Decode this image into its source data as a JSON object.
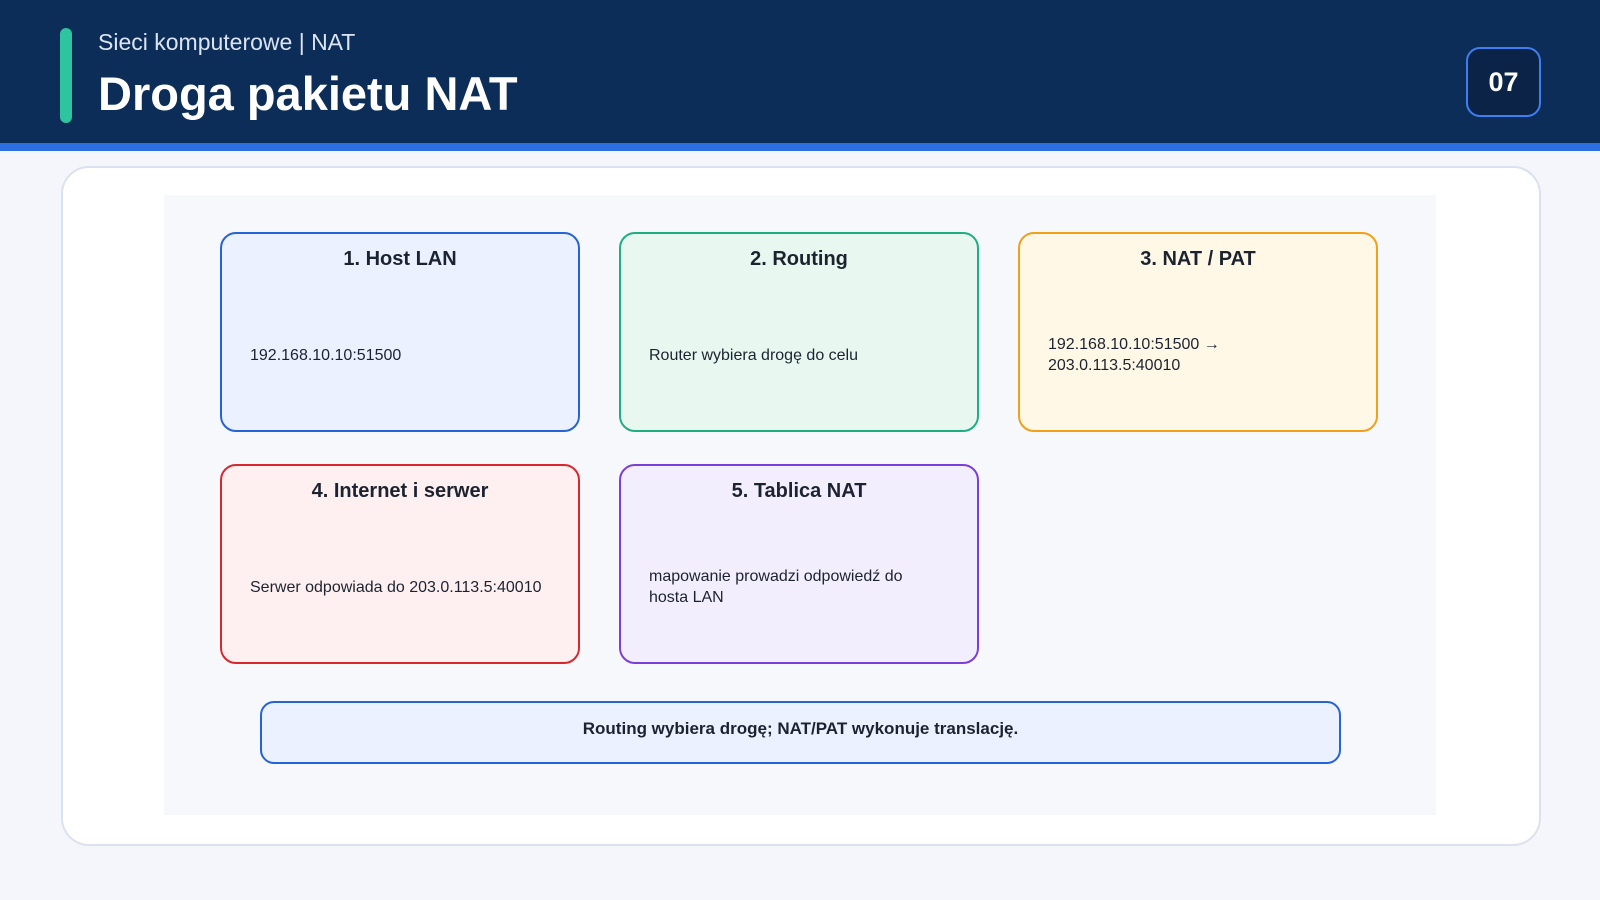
{
  "header": {
    "subtitle": "Sieci komputerowe | NAT",
    "title": "Droga pakietu NAT",
    "slide_number": "07"
  },
  "colors": {
    "header_bg": "#0c2d57",
    "header_underline": "#2b6fe0",
    "accent": "#2ec4a0",
    "box_host_lan": "#2563d6",
    "box_routing": "#1fae82",
    "box_nat_pat": "#f0a01a",
    "box_internet": "#d9282d",
    "box_nat_table": "#7b3fd9"
  },
  "diagram": {
    "boxes": [
      {
        "title": "1. Host LAN",
        "body": "192.168.10.10:51500"
      },
      {
        "title": "2. Routing",
        "body": "Router wybiera drogę do celu"
      },
      {
        "title": "3. NAT / PAT",
        "body": "192.168.10.10:51500 →\n203.0.113.5:40010"
      },
      {
        "title": "4. Internet i serwer",
        "body": "Serwer odpowiada do 203.0.113.5:40010"
      },
      {
        "title": "5. Tablica NAT",
        "body": "mapowanie prowadzi odpowiedź do\nhosta LAN"
      }
    ],
    "summary": "Routing wybiera drogę; NAT/PAT wykonuje translację."
  }
}
